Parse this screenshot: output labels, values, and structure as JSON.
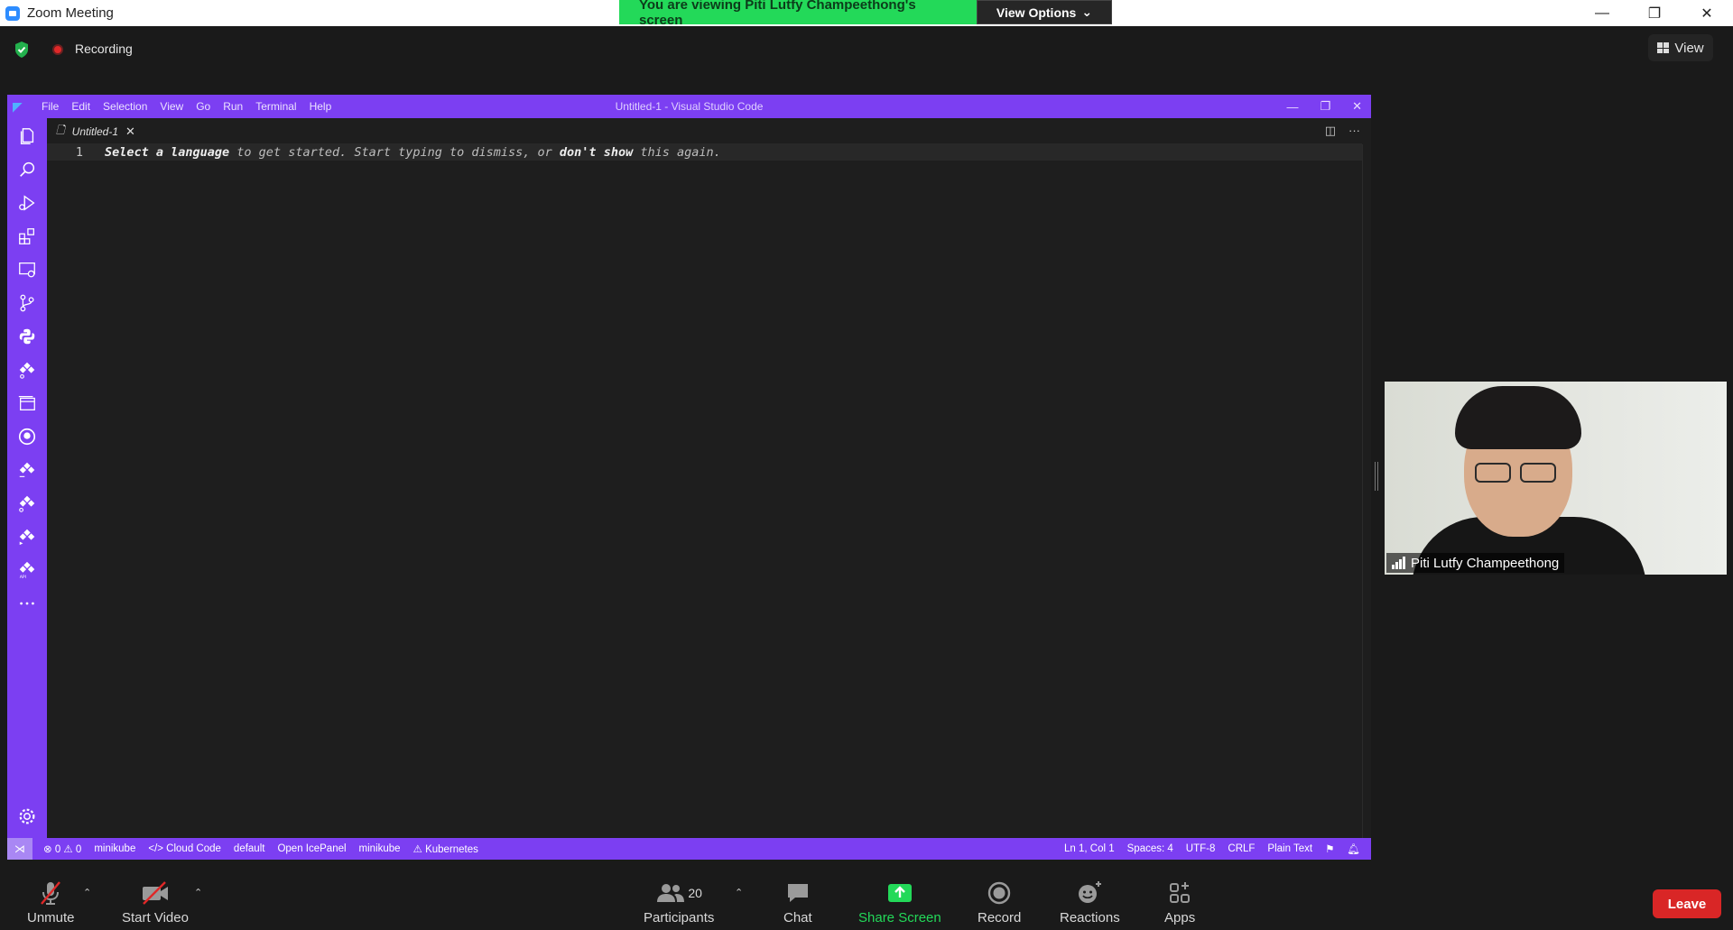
{
  "window": {
    "title": "Zoom Meeting",
    "controls": [
      "—",
      "❐",
      "✕"
    ]
  },
  "banner": {
    "text": "You are viewing Piti Lutfy Champeethong's screen",
    "options_label": "View Options"
  },
  "meeting": {
    "recording_label": "Recording",
    "view_label": "View"
  },
  "vscode": {
    "menu": [
      "File",
      "Edit",
      "Selection",
      "View",
      "Go",
      "Run",
      "Terminal",
      "Help"
    ],
    "window_title": "Untitled-1 - Visual Studio Code",
    "tab_label": "Untitled-1",
    "line_number": "1",
    "hint": {
      "p1": "Select a language",
      "p2": " to get started. Start typing to dismiss, or ",
      "p3": "don't show",
      "p4": " this again."
    },
    "status_left": {
      "problems": "⊗ 0 ⚠ 0",
      "context1": "minikube",
      "cloud_code": "</> Cloud Code",
      "namespace": "default",
      "icepanel": "Open IcePanel",
      "context2": "minikube",
      "kubernetes": "⚠ Kubernetes"
    },
    "status_right": {
      "position": "Ln 1, Col 1",
      "spaces": "Spaces: 4",
      "encoding": "UTF-8",
      "eol": "CRLF",
      "language": "Plain Text"
    },
    "activity_icons": [
      "explorer-icon",
      "search-icon",
      "run-debug-icon",
      "extensions-icon",
      "remote-explorer-icon",
      "source-control-icon",
      "python-icon",
      "kubernetes-icon",
      "panel-icon",
      "github-icon",
      "cloud-code-icon",
      "cloud-run-icon",
      "deploy-icon",
      "api-icon",
      "more-icon",
      "settings-gear-icon"
    ]
  },
  "participant": {
    "name": "Piti Lutfy Champeethong"
  },
  "toolbar": {
    "unmute": "Unmute",
    "start_video": "Start Video",
    "participants": "Participants",
    "participants_count": "20",
    "chat": "Chat",
    "share_screen": "Share Screen",
    "record": "Record",
    "reactions": "Reactions",
    "apps": "Apps",
    "leave": "Leave"
  },
  "colors": {
    "banner_green": "#23d959",
    "vscode_purple": "#7c3ff2",
    "leave_red": "#d92626"
  }
}
